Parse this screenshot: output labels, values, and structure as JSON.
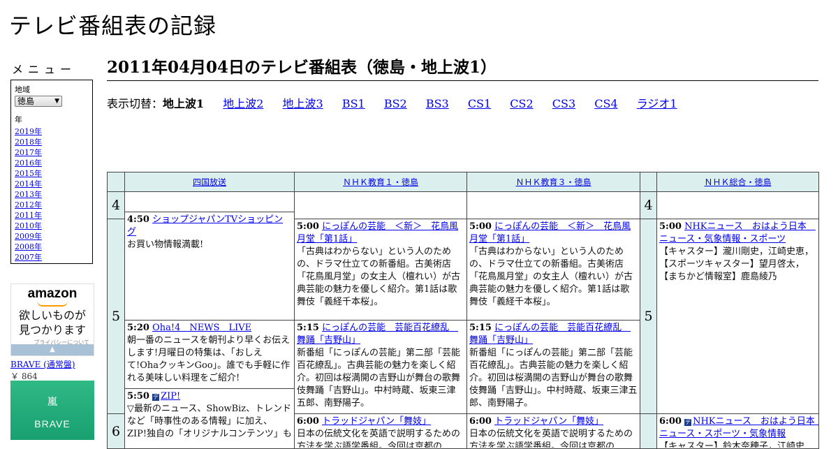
{
  "site": {
    "title": "テレビ番組表の記録"
  },
  "sidebar": {
    "menu_title": "メニュー",
    "region_label": "地域",
    "region_value": "徳島",
    "year_label": "年",
    "years": [
      "2019年",
      "2018年",
      "2017年",
      "2016年",
      "2015年",
      "2014年",
      "2013年",
      "2012年",
      "2011年",
      "2010年",
      "2009年",
      "2008年",
      "2007年"
    ]
  },
  "ad": {
    "logo": "amazon",
    "tagline_1": "欲しいものが",
    "tagline_2": "見つかります",
    "privacy": "プライバシーについて",
    "product_title": "BRAVE (通常盤)",
    "product_price": "￥ 864",
    "product_image_line1": "嵐",
    "product_image_line2": "BRAVE"
  },
  "main": {
    "heading": "2011年04月04日のテレビ番組表（徳島・地上波1）",
    "switch_label": "表示切替：",
    "switch_current": "地上波1",
    "switch_links": [
      "地上波2",
      "地上波3",
      "BS1",
      "BS2",
      "BS3",
      "CS1",
      "CS2",
      "CS3",
      "CS4",
      "ラジオ1"
    ]
  },
  "schedule": {
    "channels": [
      "四国放送",
      "ＮＨＫ教育１・徳島",
      "ＮＨＫ教育３・徳島",
      "ＮＨＫ総合・徳島"
    ],
    "hours": [
      "4",
      "5",
      "6"
    ],
    "programs": {
      "shikoku_450": {
        "time": "4:50",
        "title": "ショップジャパンTVショッピング",
        "desc": "お買い物情報満載!"
      },
      "shikoku_520": {
        "time": "5:20",
        "title": "Oha!4　NEWS　LIVE",
        "desc": "朝一番のニュースを朝刊より早くお伝えします!月曜日の特集は、「おしえて!OhaクッキンGoo」。誰でも手軽に作れる美味しい料理をご紹介!"
      },
      "shikoku_550": {
        "time": "5:50",
        "title": "ZIP!",
        "desc": "▽最新のニュース、ShowBiz、トレンドなど「時事性のある情報」に加え、ZIP!独自の「オリジナルコンテンツ」も多数"
      },
      "edu1_500": {
        "time": "5:00",
        "title": "にっぽんの芸能　＜新＞　花鳥風月堂「第1話」",
        "desc": "「古典はわからない」という人のための、ドラマ仕立ての新番組。古美術店「花鳥風月堂」の女主人（檀れい）が古典芸能の魅力を優しく紹介。第1話は歌舞伎「義経千本桜」。"
      },
      "edu1_515": {
        "time": "5:15",
        "title": "にっぽんの芸能　芸能百花繚乱　舞踊「吉野山」",
        "desc": "新番組「にっぽんの芸能」第二部「芸能百花繚乱」。古典芸能の魅力を楽しく紹介。初回は桜満開の吉野山が舞台の歌舞伎舞踊「吉野山」。中村時蔵、坂東三津五郎、南野陽子。"
      },
      "edu1_600": {
        "time": "6:00",
        "title": "トラッドジャパン「舞妓」",
        "desc": "日本の伝統文化を英語で説明するための方法を学ぶ語学番組。今回は京都の"
      },
      "edu3_500": {
        "time": "5:00",
        "title": "にっぽんの芸能　＜新＞　花鳥風月堂「第1話」",
        "desc": "「古典はわからない」という人のための、ドラマ仕立ての新番組。古美術店「花鳥風月堂」の女主人（檀れい）が古典芸能の魅力を優しく紹介。第1話は歌舞伎「義経千本桜」。"
      },
      "edu3_515": {
        "time": "5:15",
        "title": "にっぽんの芸能　芸能百花繚乱　舞踊「吉野山」",
        "desc": "新番組「にっぽんの芸能」第二部「芸能百花繚乱」。古典芸能の魅力を楽しく紹介。初回は桜満開の吉野山が舞台の歌舞伎舞踊「吉野山」。中村時蔵、坂東三津五郎、南野陽子。"
      },
      "edu3_600": {
        "time": "6:00",
        "title": "トラッドジャパン「舞妓」",
        "desc": "日本の伝統文化を英語で説明するための方法を学ぶ語学番組。今回は京都の"
      },
      "nhk_500": {
        "time": "5:00",
        "title": "NHKニュース　おはよう日本　ニュース・気象情報・スポーツ",
        "desc": "【キャスター】瀧川剛史，江崎史恵，【スポーツキャスター】望月啓太，【まちかど情報室】鹿島綾乃"
      },
      "nhk_600": {
        "time": "6:00",
        "title": "NHKニュース　おはよう日本　ニュース・スポーツ・気象情報",
        "desc": "【キャスター】鈴木奈穂子，江崎史"
      }
    }
  }
}
